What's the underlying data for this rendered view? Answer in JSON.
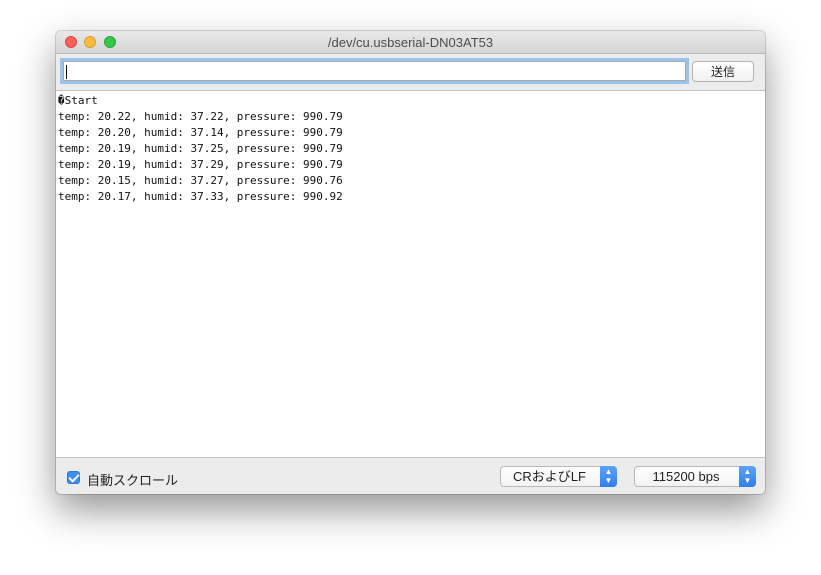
{
  "window": {
    "title": "/dev/cu.usbserial-DN03AT53"
  },
  "toolbar": {
    "input_value": "",
    "send_label": "送信"
  },
  "output": {
    "lines": [
      "�Start",
      "temp: 20.22, humid: 37.22, pressure: 990.79",
      "temp: 20.20, humid: 37.14, pressure: 990.79",
      "temp: 20.19, humid: 37.25, pressure: 990.79",
      "temp: 20.19, humid: 37.29, pressure: 990.79",
      "temp: 20.15, humid: 37.27, pressure: 990.76",
      "temp: 20.17, humid: 37.33, pressure: 990.92"
    ]
  },
  "statusbar": {
    "autoscroll_label": "自動スクロール",
    "autoscroll_checked": true,
    "line_ending": "CRおよびLF",
    "baud_rate": "115200 bps"
  },
  "colors": {
    "accent": "#3b8ff2",
    "focus_ring": "#9bc3f0"
  }
}
